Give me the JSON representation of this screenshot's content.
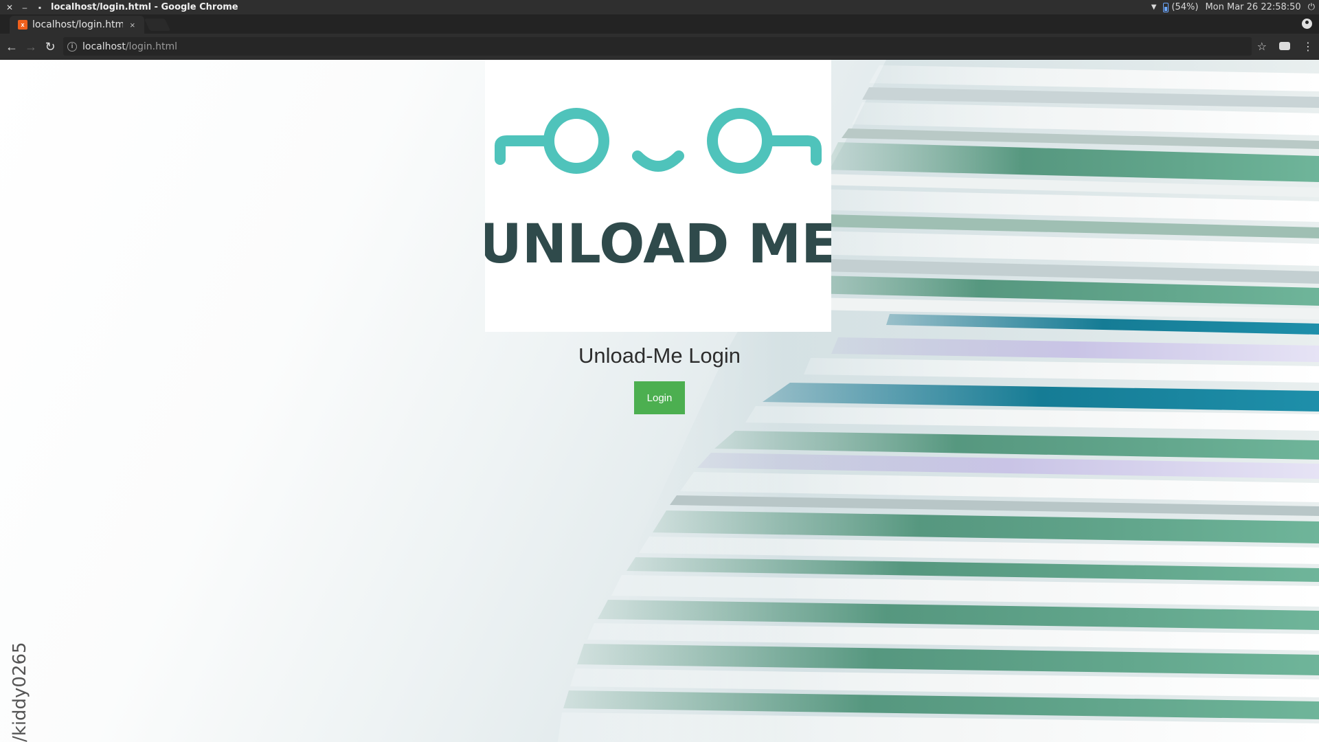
{
  "system": {
    "window_title": "localhost/login.html - Google Chrome",
    "battery": "(54%)",
    "clock": "Mon Mar 26 22:58:50"
  },
  "browser": {
    "tab_title": "localhost/login.htm",
    "tab_close": "×",
    "url_host": "localhost",
    "url_path": "/login.html"
  },
  "icons": {
    "close": "✕",
    "minimize": "–",
    "maximize": "▪",
    "back": "←",
    "forward": "→",
    "reload": "↻",
    "star": "☆",
    "menu": "⋮",
    "wifi": "▼",
    "power": "⏻"
  },
  "page": {
    "logo_text": "UNLOAD ME",
    "title": "Unload-Me Login",
    "login_button": "Login"
  },
  "overlay": {
    "watermark": "/kiddy0265"
  },
  "colors": {
    "logo_teal": "#4fc3bb",
    "logo_dark": "#2f4a4b",
    "login_green": "#4caf50"
  }
}
